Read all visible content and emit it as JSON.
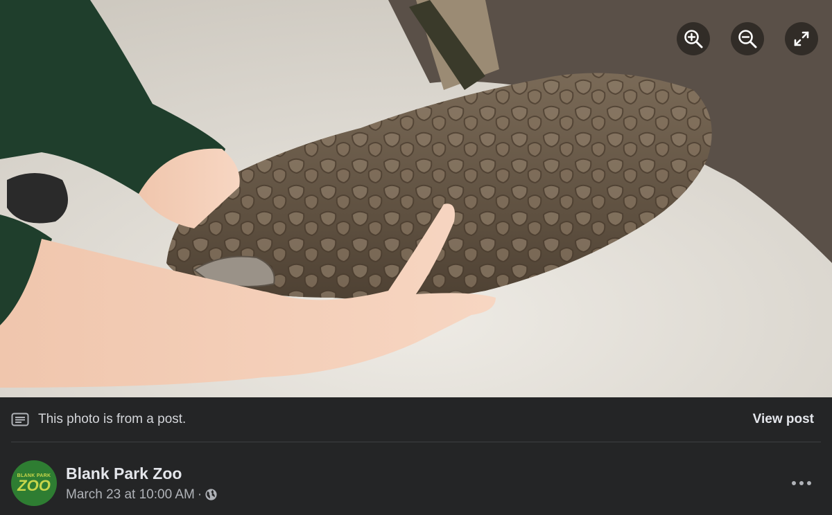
{
  "photo": {
    "alt": "",
    "icons": {
      "zoom_in": "zoom-in-icon",
      "zoom_out": "zoom-out-icon",
      "fullscreen": "expand-icon"
    }
  },
  "post_notice": {
    "icon": "post-text-icon",
    "text": "This photo is from a post.",
    "view_post_label": "View post"
  },
  "author": {
    "name": "Blank Park Zoo",
    "avatar_logo_top": "BLANK PARK",
    "avatar_logo_main": "ZOO",
    "timestamp": "March 23 at 10:00 AM",
    "separator": "·",
    "privacy_icon": "globe-icon",
    "more_icon": "more-dots-icon"
  },
  "colors": {
    "background": "#242526",
    "text_primary": "#e4e6eb",
    "text_secondary": "#b0b3b8",
    "divider": "#3e4042",
    "avatar_bg": "#2e7d32"
  }
}
